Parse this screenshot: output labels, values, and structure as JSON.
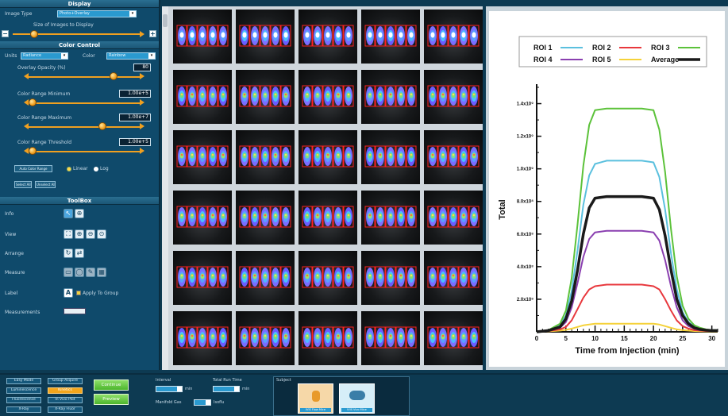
{
  "display": {
    "section_title": "Display",
    "image_type_label": "Image Type",
    "image_type_value": "Photo+Overlay",
    "size_label": "Size of Images to Display",
    "size_minus": "−",
    "size_plus": "+"
  },
  "color_control": {
    "section_title": "Color Control",
    "units_label": "Units",
    "units_value": "Radiance",
    "color_label": "Color",
    "color_value": "Rainbow",
    "overlay_opacity_label": "Overlay Opacity (%)",
    "overlay_opacity_value": "80",
    "range_min_label": "Color Range Minimum",
    "range_min_value": "1.00e+5",
    "range_max_label": "Color Range Maximum",
    "range_max_value": "1.00e+7",
    "threshold_label": "Color Range Threshold",
    "threshold_value": "1.00e+5",
    "auto_button": "Auto Color Range",
    "linear_label": "Linear",
    "log_label": "Log",
    "select_all": "Select All",
    "unselect_all": "Unselect All"
  },
  "toolbox": {
    "section_title": "ToolBox",
    "info_label": "Info",
    "view_label": "View",
    "arrange_label": "Arrange",
    "measure_label": "Measure",
    "label_label": "Label",
    "label_icon": "A",
    "apply_group": "Apply To Group",
    "measurements_label": "Measurements"
  },
  "chart_data": {
    "type": "line",
    "title": "",
    "xlabel": "Time from Injection (min)",
    "ylabel": "Total",
    "xlim": [
      0,
      31
    ],
    "ylim": [
      0,
      1.5
    ],
    "x_ticks": [
      "0",
      "5",
      "10",
      "15",
      "20",
      "25",
      "30"
    ],
    "y_ticks": [
      "2.0x10⁸",
      "4.0x10⁸",
      "6.0x10⁸",
      "8.0x10⁸",
      "1.0x10⁹",
      "1.2x10⁹",
      "1.4x10⁹"
    ],
    "y_tick_values": [
      0.2,
      0.4,
      0.6,
      0.8,
      1.0,
      1.2,
      1.4
    ],
    "legend_position": "top",
    "x": [
      0,
      2,
      4,
      5,
      6,
      7,
      8,
      9,
      10,
      12,
      15,
      18,
      20,
      21,
      22,
      23,
      24,
      25,
      26,
      27,
      28,
      29,
      30,
      31
    ],
    "series": [
      {
        "name": "ROI 1",
        "color": "#5bc0de",
        "values": [
          0.0,
          0.01,
          0.04,
          0.1,
          0.25,
          0.5,
          0.78,
          0.96,
          1.03,
          1.05,
          1.05,
          1.05,
          1.04,
          0.95,
          0.75,
          0.48,
          0.26,
          0.12,
          0.06,
          0.03,
          0.02,
          0.01,
          0.01,
          0.01
        ]
      },
      {
        "name": "ROI 2",
        "color": "#e8383d",
        "values": [
          0.0,
          0.005,
          0.015,
          0.03,
          0.07,
          0.14,
          0.21,
          0.26,
          0.28,
          0.29,
          0.29,
          0.29,
          0.28,
          0.26,
          0.2,
          0.13,
          0.07,
          0.035,
          0.02,
          0.01,
          0.008,
          0.005,
          0.005,
          0.005
        ]
      },
      {
        "name": "ROI 3",
        "color": "#5cc23a",
        "values": [
          0.0,
          0.01,
          0.05,
          0.13,
          0.33,
          0.66,
          1.02,
          1.27,
          1.36,
          1.37,
          1.37,
          1.37,
          1.36,
          1.24,
          0.98,
          0.63,
          0.34,
          0.16,
          0.08,
          0.04,
          0.025,
          0.015,
          0.01,
          0.01
        ]
      },
      {
        "name": "ROI 4",
        "color": "#8a3fb0",
        "values": [
          0.0,
          0.008,
          0.025,
          0.06,
          0.15,
          0.3,
          0.46,
          0.57,
          0.61,
          0.62,
          0.62,
          0.62,
          0.61,
          0.56,
          0.44,
          0.28,
          0.15,
          0.07,
          0.035,
          0.02,
          0.01,
          0.008,
          0.006,
          0.006
        ]
      },
      {
        "name": "ROI 5",
        "color": "#f5d23a",
        "values": [
          0.0,
          0.003,
          0.008,
          0.012,
          0.02,
          0.03,
          0.04,
          0.045,
          0.05,
          0.05,
          0.05,
          0.05,
          0.05,
          0.045,
          0.035,
          0.025,
          0.015,
          0.01,
          0.008,
          0.005,
          0.004,
          0.003,
          0.003,
          0.003
        ]
      },
      {
        "name": "Average",
        "color": "#1a1a1a",
        "values": [
          0.0,
          0.008,
          0.03,
          0.08,
          0.19,
          0.38,
          0.6,
          0.76,
          0.82,
          0.83,
          0.83,
          0.83,
          0.82,
          0.75,
          0.59,
          0.38,
          0.2,
          0.1,
          0.05,
          0.025,
          0.015,
          0.01,
          0.008,
          0.008
        ]
      }
    ]
  },
  "bottom": {
    "modes": [
      {
        "label": "Easy Mode",
        "active": false
      },
      {
        "label": "Group Acquire",
        "active": false
      },
      {
        "label": "Luminescence",
        "active": false
      },
      {
        "label": "Kinetics",
        "active": true
      },
      {
        "label": "Fluorescence",
        "active": false
      },
      {
        "label": "In Vivo Plot",
        "active": false
      },
      {
        "label": "X-Ray",
        "active": false
      },
      {
        "label": "X-Ray Fluor",
        "active": false
      }
    ],
    "continue_button": "Continue",
    "preview_button": "Preview",
    "interval_label": "Interval",
    "interval_unit": "min",
    "total_run_label": "Total Run Time",
    "total_run_unit": "min",
    "manifold_label": "Manifold Gas",
    "manifold_unit": "Isoflu",
    "subject_label": "Subject",
    "subject_cards": [
      {
        "caption": "IVIS Flow Mice"
      },
      {
        "caption": "IVIS Vivo Mice"
      }
    ]
  },
  "colors": {
    "accent": "#f0a020",
    "panel": "#0f4a6b",
    "background": "#0d3a52"
  }
}
